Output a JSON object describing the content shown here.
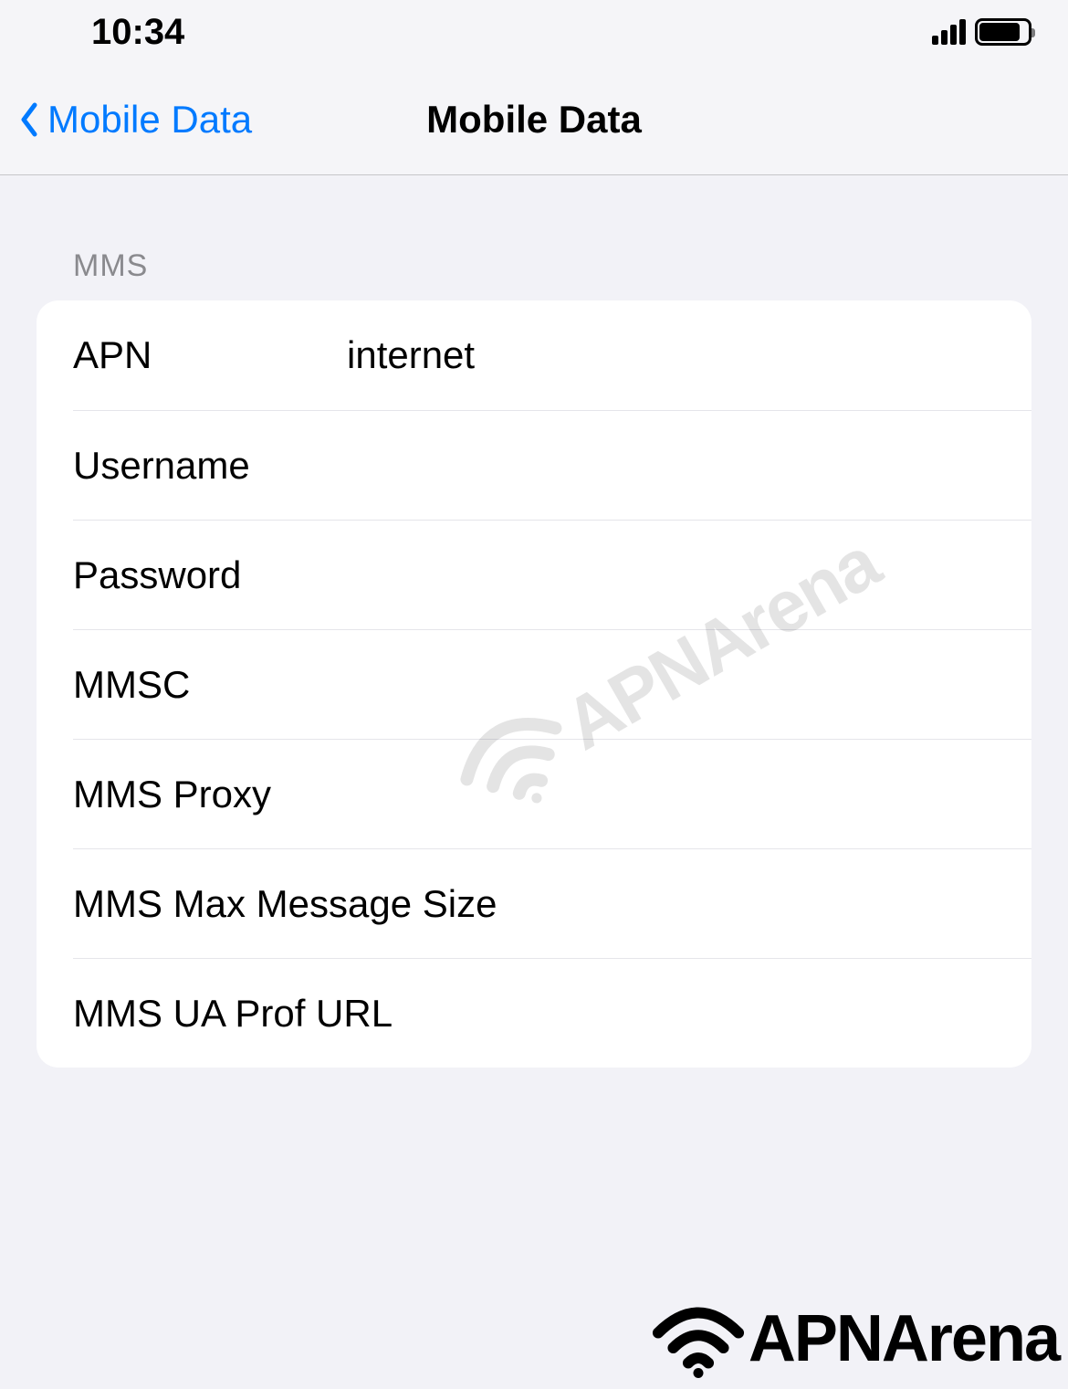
{
  "status_bar": {
    "time": "10:34"
  },
  "nav": {
    "back_label": "Mobile Data",
    "title": "Mobile Data"
  },
  "section": {
    "header": "MMS",
    "rows": {
      "apn": {
        "label": "APN",
        "value": "internet"
      },
      "username": {
        "label": "Username",
        "value": ""
      },
      "password": {
        "label": "Password",
        "value": ""
      },
      "mmsc": {
        "label": "MMSC",
        "value": ""
      },
      "mms_proxy": {
        "label": "MMS Proxy",
        "value": ""
      },
      "mms_max_size": {
        "label": "MMS Max Message Size",
        "value": ""
      },
      "mms_ua_prof": {
        "label": "MMS UA Prof URL",
        "value": ""
      }
    }
  },
  "watermark": {
    "text": "APNArena"
  }
}
